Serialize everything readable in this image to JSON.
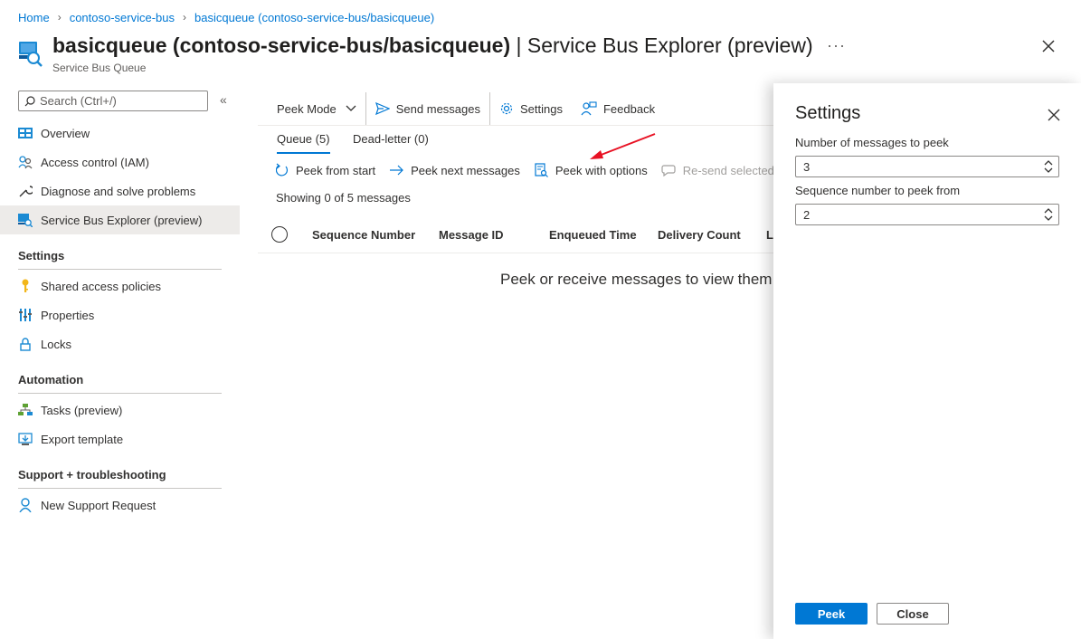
{
  "breadcrumb": [
    "Home",
    "contoso-service-bus",
    "basicqueue (contoso-service-bus/basicqueue)"
  ],
  "header": {
    "title_bold": "basicqueue (contoso-service-bus/basicqueue)",
    "title_rest": " | Service Bus Explorer (preview)",
    "subtitle": "Service Bus Queue",
    "more": "···"
  },
  "sidebar": {
    "search_placeholder": "Search (Ctrl+/)",
    "collapse": "«",
    "items": [
      {
        "label": "Overview",
        "icon": "overview-icon"
      },
      {
        "label": "Access control (IAM)",
        "icon": "people-icon"
      },
      {
        "label": "Diagnose and solve problems",
        "icon": "wrench-icon"
      },
      {
        "label": "Service Bus Explorer (preview)",
        "icon": "explorer-icon",
        "active": true
      }
    ],
    "sections": [
      {
        "title": "Settings",
        "items": [
          {
            "label": "Shared access policies",
            "icon": "key-icon"
          },
          {
            "label": "Properties",
            "icon": "properties-icon"
          },
          {
            "label": "Locks",
            "icon": "lock-icon"
          }
        ]
      },
      {
        "title": "Automation",
        "items": [
          {
            "label": "Tasks (preview)",
            "icon": "tasks-icon"
          },
          {
            "label": "Export template",
            "icon": "export-icon"
          }
        ]
      },
      {
        "title": "Support + troubleshooting",
        "items": [
          {
            "label": "New Support Request",
            "icon": "support-icon"
          }
        ]
      }
    ]
  },
  "toolbar": {
    "peek_mode": "Peek Mode",
    "send": "Send messages",
    "settings": "Settings",
    "feedback": "Feedback"
  },
  "tabs": [
    "Queue (5)",
    "Dead-letter (0)"
  ],
  "actions": {
    "peek_start": "Peek from start",
    "peek_next": "Peek next messages",
    "peek_options": "Peek with options",
    "resend": "Re-send selected m"
  },
  "showing": "Showing 0 of 5 messages",
  "columns": [
    "Sequence Number",
    "Message ID",
    "Enqueued Time",
    "Delivery Count",
    "La"
  ],
  "empty_text": "Peek or receive messages to view them",
  "panel": {
    "title": "Settings",
    "count_label": "Number of messages to peek",
    "count_value": "3",
    "seq_label": "Sequence number to peek from",
    "seq_value": "2",
    "peek": "Peek",
    "close": "Close"
  },
  "colors": {
    "accent": "#0078d4",
    "arrow": "#e81123"
  }
}
